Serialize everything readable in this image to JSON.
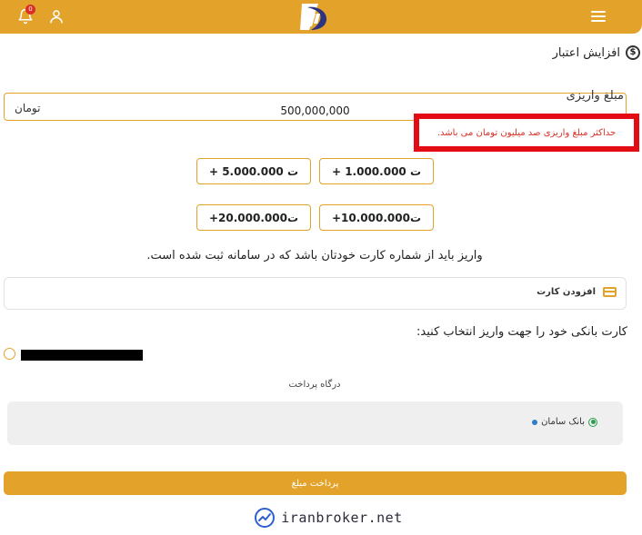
{
  "header": {
    "notification_count": "0",
    "colors": {
      "bar": "#e3a22a",
      "badge": "#d93025"
    }
  },
  "page": {
    "title": "افزایش اعتبار"
  },
  "amount": {
    "label": "مبلغ واریزی",
    "value": "500,000,000",
    "unit": "تومان",
    "error": "حداکثر مبلغ واریزی صد میلیون تومان می باشد."
  },
  "presets": [
    {
      "label": "+ 1.000.000 ت"
    },
    {
      "label": "+ 5.000.000 ت"
    },
    {
      "label": "+10.000.000ت"
    },
    {
      "label": "+20.000.000ت"
    }
  ],
  "notice": "واریز باید از شماره کارت خودتان باشد که در سامانه ثبت شده است.",
  "add_card": {
    "label": "افزودن کارت"
  },
  "cards": {
    "select_prompt": "کارت بانکی خود را جهت واریز انتخاب کنید:"
  },
  "gateway": {
    "title": "درگاه پرداخت",
    "options": [
      {
        "label": "بانک سامان"
      }
    ]
  },
  "pay_button": {
    "label": "پرداخت مبلغ"
  },
  "watermark": {
    "text": "iranbroker.net"
  }
}
